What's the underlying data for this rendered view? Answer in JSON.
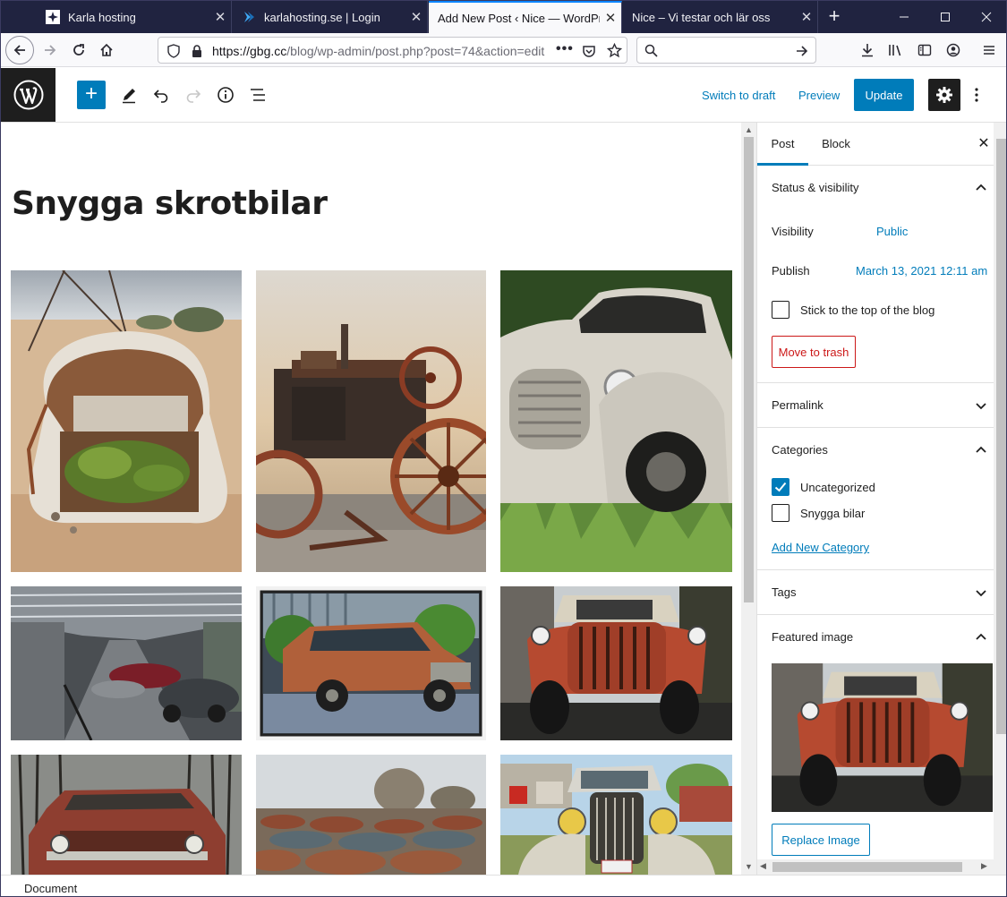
{
  "browser": {
    "tabs": [
      {
        "title": "Karla hosting",
        "icon": "karla-hosting-favicon",
        "active": false
      },
      {
        "title": "karlahosting.se | Login",
        "icon": "karlahosting-login-favicon",
        "active": false
      },
      {
        "title": "Add New Post ‹ Nice — WordPress",
        "icon": "",
        "active": true
      },
      {
        "title": "Nice – Vi testar och lär oss",
        "icon": "",
        "active": false
      }
    ],
    "new_tab_icon": "plus-icon",
    "url_domain": "https://gbg.cc",
    "url_path": "/blog/wp-admin/post.php?post=74&action=edit",
    "search_placeholder": ""
  },
  "editor": {
    "switch_to_draft": "Switch to draft",
    "preview": "Preview",
    "update": "Update"
  },
  "post": {
    "title": "Snygga skrotbilar",
    "gallery": [
      {
        "subject": "rusted-beetle-desert"
      },
      {
        "subject": "rusted-steam-tractor"
      },
      {
        "subject": "white-vintage-truck"
      },
      {
        "subject": "car-museum-hall"
      },
      {
        "subject": "rusty-station-wagon"
      },
      {
        "subject": "red-rusted-truck-front"
      },
      {
        "subject": "red-pickup-forest"
      },
      {
        "subject": "car-scrapyard"
      },
      {
        "subject": "vintage-car-39289"
      }
    ]
  },
  "sidebar": {
    "tab_post": "Post",
    "tab_block": "Block",
    "status_visibility": "Status & visibility",
    "visibility_label": "Visibility",
    "visibility_value": "Public",
    "publish_label": "Publish",
    "publish_value": "March 13, 2021 12:11 am",
    "sticky_label": "Stick to the top of the blog",
    "move_to_trash": "Move to trash",
    "permalink": "Permalink",
    "categories": "Categories",
    "category_items": [
      {
        "label": "Uncategorized",
        "checked": true
      },
      {
        "label": "Snygga bilar",
        "checked": false
      }
    ],
    "add_new_category": "Add New Category",
    "tags": "Tags",
    "featured_image": "Featured image",
    "replace_image": "Replace Image"
  },
  "statusbar": {
    "text": "Document"
  },
  "colors": {
    "accent": "#007cba",
    "tabstrip": "#202340",
    "danger": "#cc1818",
    "wp_dark": "#1e1e1e"
  }
}
